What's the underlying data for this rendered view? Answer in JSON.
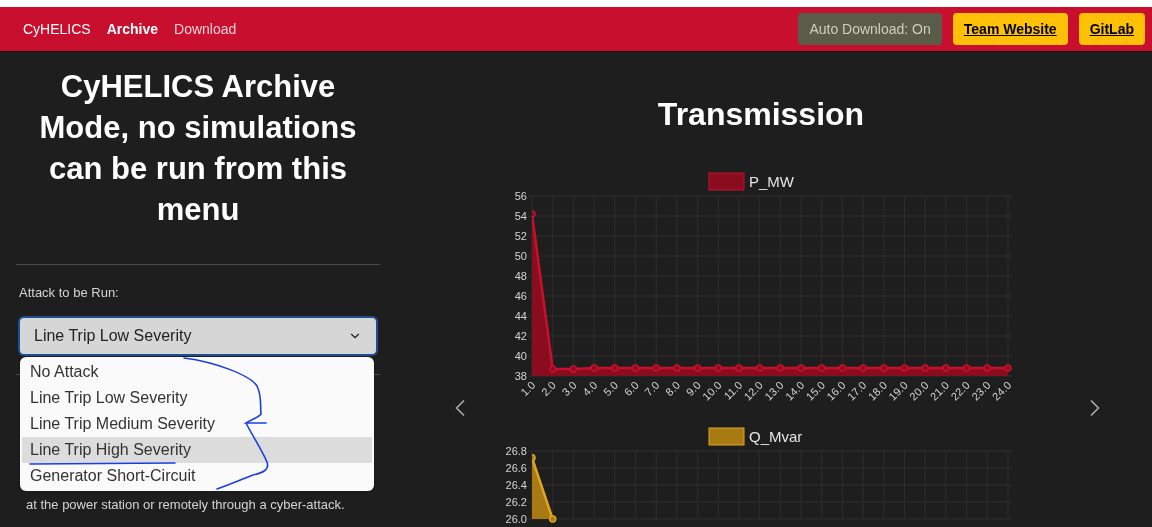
{
  "navbar": {
    "brand": "CyHELICS",
    "links": [
      {
        "label": "Archive",
        "selected": true
      },
      {
        "label": "Download",
        "selected": false
      }
    ],
    "buttons": [
      {
        "label": "Auto Download: On",
        "kind": "status"
      },
      {
        "label": "Team Website",
        "kind": "link"
      },
      {
        "label": "GitLab",
        "kind": "link"
      }
    ]
  },
  "sidebar": {
    "title": "CyHELICS Archive Mode, no simulations can be run from this menu",
    "attack_label": "Attack to be Run:",
    "select": {
      "value": "Line Trip Low Severity",
      "expanded": true,
      "options": [
        {
          "label": "No Attack",
          "highlighted": false
        },
        {
          "label": "Line Trip Low Severity",
          "highlighted": false
        },
        {
          "label": "Line Trip Medium Severity",
          "highlighted": false
        },
        {
          "label": "Line Trip High Severity",
          "highlighted": true
        },
        {
          "label": "Generator Short-Circuit",
          "highlighted": false
        }
      ]
    },
    "description": "at the power station or remotely through a cyber-attack."
  },
  "main": {
    "title": "Transmission",
    "charts": [
      {
        "chart_data": {
          "type": "area",
          "grid": true,
          "categories": [
            "1.0",
            "2.0",
            "3.0",
            "4.0",
            "5.0",
            "6.0",
            "7.0",
            "8.0",
            "9.0",
            "10.0",
            "11.0",
            "12.0",
            "13.0",
            "14.0",
            "15.0",
            "16.0",
            "17.0",
            "18.0",
            "19.0",
            "20.0",
            "21.0",
            "22.0",
            "23.0",
            "24.0"
          ],
          "series": [
            {
              "name": "P_MW",
              "color": "#c8102e",
              "values": [
                54.2,
                38.7,
                38.7,
                38.8,
                38.8,
                38.8,
                38.8,
                38.8,
                38.8,
                38.8,
                38.8,
                38.8,
                38.8,
                38.8,
                38.8,
                38.8,
                38.8,
                38.8,
                38.8,
                38.8,
                38.8,
                38.8,
                38.8,
                38.8
              ]
            }
          ],
          "ylim": [
            38,
            56
          ],
          "yticks": [
            38,
            40,
            42,
            44,
            46,
            48,
            50,
            52,
            54,
            56
          ]
        }
      },
      {
        "chart_data": {
          "type": "area",
          "grid": true,
          "series": [
            {
              "name": "Q_Mvar",
              "color": "#e0a526",
              "values": [
                26.72,
                26.0,
                null,
                null,
                null,
                null,
                null,
                null,
                null,
                null,
                null,
                null,
                null,
                null,
                null,
                null,
                null,
                null,
                null,
                null,
                null,
                null,
                null,
                null
              ]
            }
          ],
          "ylim": [
            26.0,
            26.8
          ],
          "yticks": [
            {
              "value": 26.0,
              "label": "26.0"
            },
            {
              "value": 26.2,
              "label": "26.2"
            },
            {
              "value": 26.4,
              "label": "26.4"
            },
            {
              "value": 26.6,
              "label": "26.6"
            },
            {
              "value": 26.8,
              "label": "26.8"
            }
          ]
        }
      }
    ]
  }
}
